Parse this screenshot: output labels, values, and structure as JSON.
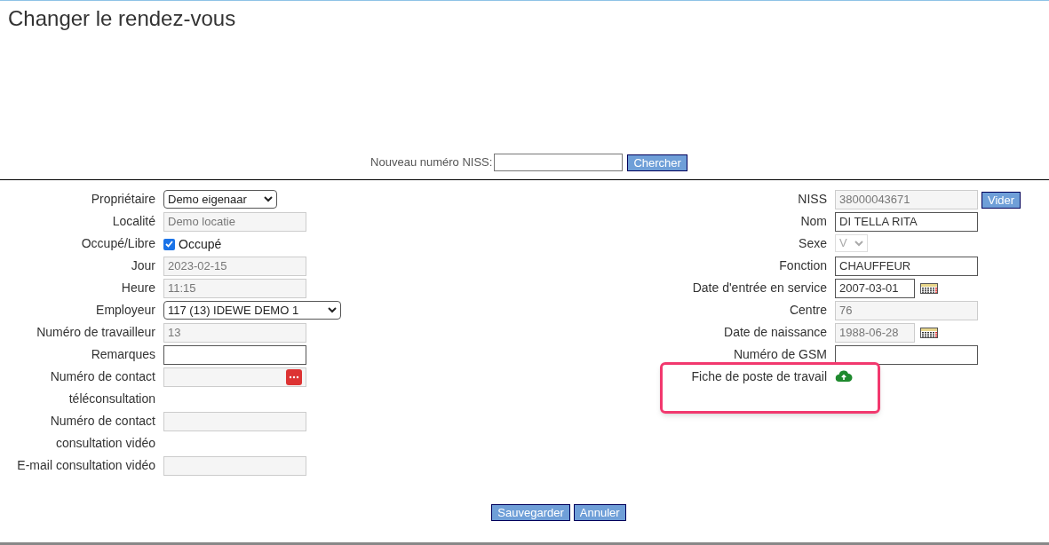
{
  "title": "Changer le rendez-vous",
  "search": {
    "label": "Nouveau numéro NISS:",
    "button": "Chercher"
  },
  "left_fields": [
    {
      "label": "Propriétaire",
      "kind": "select",
      "value": "Demo eigenaar",
      "disabled": false
    },
    {
      "label": "Localité",
      "kind": "input",
      "value": "Demo locatie",
      "disabled": true
    },
    {
      "label": "Occupé/Libre",
      "kind": "checkbox",
      "value": "Occupé",
      "checked": true
    },
    {
      "label": "Jour",
      "kind": "input",
      "value": "2023-02-15",
      "disabled": true
    },
    {
      "label": "Heure",
      "kind": "input",
      "value": "11:15",
      "disabled": true
    },
    {
      "label": "Employeur",
      "kind": "wide_select",
      "value": "117 (13) IDEWE DEMO 1",
      "disabled": false
    },
    {
      "label": "Numéro de travailleur",
      "kind": "input",
      "value": "13",
      "disabled": true
    },
    {
      "label": "Remarques",
      "kind": "input",
      "disabled": false
    },
    {
      "label": "Numéro de contact téléconsultation",
      "kind": "phone",
      "disabled": true
    },
    {
      "label": "Numéro de contact consultation vidéo",
      "kind": "input",
      "disabled": true
    },
    {
      "label": "E-mail consultation vidéo",
      "kind": "input",
      "disabled": true
    }
  ],
  "right_fields": [
    {
      "label": "NISS",
      "kind": "input",
      "value": "38000043671",
      "disabled": true,
      "button": "Vider"
    },
    {
      "label": "Nom",
      "kind": "input",
      "value": "DI TELLA RITA",
      "disabled": false
    },
    {
      "label": "Sexe",
      "kind": "small_select",
      "value": "V",
      "disabled": true
    },
    {
      "label": "Fonction",
      "kind": "input",
      "value": "CHAUFFEUR",
      "disabled": false
    },
    {
      "label": "Date d'entrée en service",
      "kind": "date",
      "value": "2007-03-01",
      "disabled": false
    },
    {
      "label": "Centre",
      "kind": "input",
      "value": "76",
      "disabled": true
    },
    {
      "label": "Date de naissance",
      "kind": "date",
      "value": "1988-06-28",
      "disabled": true
    },
    {
      "label": "Numéro de GSM",
      "kind": "input",
      "disabled": false
    },
    {
      "label": "Fiche de poste de travail",
      "kind": "upload",
      "highlighted": true
    }
  ],
  "buttons": [
    "Sauvegarder",
    "Annuler"
  ]
}
